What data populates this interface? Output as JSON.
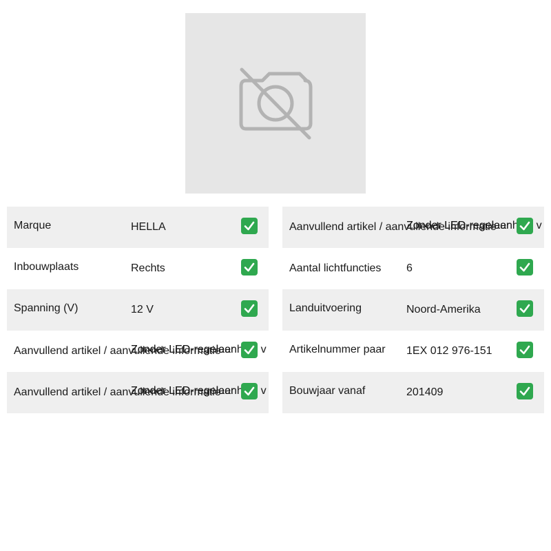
{
  "image": {
    "icon": "camera-off-icon"
  },
  "colors": {
    "row_shade": "#efefef",
    "placeholder_bg": "#e6e6e6",
    "icon_gray": "#b3b3b3",
    "check_green": "#2fa84f"
  },
  "left_table": [
    {
      "label": "Marque",
      "value": "HELLA"
    },
    {
      "label": "Inbouwplaats",
      "value": "Rechts"
    },
    {
      "label": "Spanning (V)",
      "value": "12 V"
    },
    {
      "label": "Aanvullend artikel / aanvullende informatie",
      "value": "Zonder LED-regelaar",
      "value_overlap": "Zonder LED-regeleenheid v"
    },
    {
      "label": "Aanvullend artikel / aanvullende informatie",
      "value": "Zonder LED-regelaar",
      "value_overlap": "Zonder LED-regeleenheid v"
    }
  ],
  "right_table": [
    {
      "label": "Aanvullend artikel / aanvullende informatie",
      "value": "Zonder LED-regelaar",
      "value_overlap": "Zonder LED-regeleenheid v"
    },
    {
      "label": "Aantal lichtfuncties",
      "value": "6"
    },
    {
      "label": "Landuitvoering",
      "value": "Noord-Amerika"
    },
    {
      "label": "Artikelnummer paar",
      "value": "1EX 012 976-151"
    },
    {
      "label": "Bouwjaar vanaf",
      "value": "201409"
    }
  ],
  "check_icon": "check-mark-icon"
}
